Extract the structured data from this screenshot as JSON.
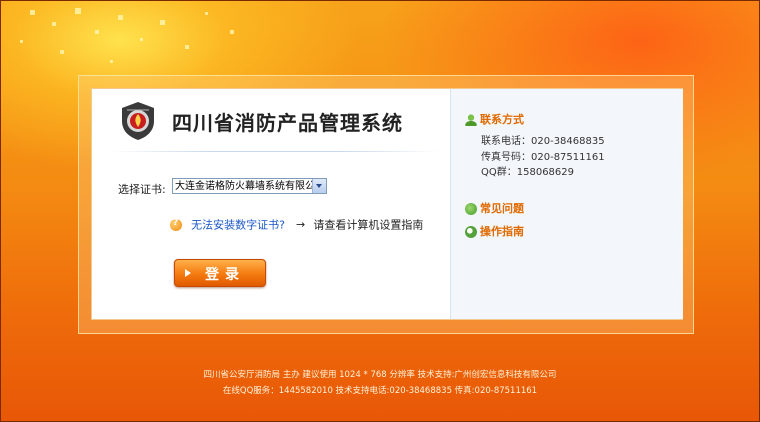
{
  "header": {
    "title": "四川省消防产品管理系统"
  },
  "login_form": {
    "cert_label": "选择证书:",
    "cert_selected": "大连金诺格防火幕墙系统有限公",
    "help_link": "无法安装数字证书?",
    "help_arrow": "→",
    "help_text": "请查看计算机设置指南",
    "login_button": "登录"
  },
  "sidebar": {
    "contact_title": "联系方式",
    "phone": "联系电话：020-38468835",
    "fax": "传真号码：020-87511161",
    "qq_group": "QQ群：158068629",
    "faq_link": "常见问题",
    "guide_link": "操作指南"
  },
  "footer": {
    "line1": "四川省公安厅消防局 主办 建议使用 1024 * 768 分辨率 技术支持:广州创宏信息科技有限公司",
    "line2": "在线QQ服务：1445582010 技术支持电话:020-38468835 传真:020-87511161"
  },
  "colors": {
    "accent": "#e06a00",
    "link": "#1a57c8",
    "button": "#f47a10"
  },
  "icons": [
    "fire-emblem-icon",
    "question-icon",
    "contact-person-icon",
    "faq-icon",
    "guide-icon",
    "play-arrow-icon",
    "dropdown-arrow-icon"
  ]
}
